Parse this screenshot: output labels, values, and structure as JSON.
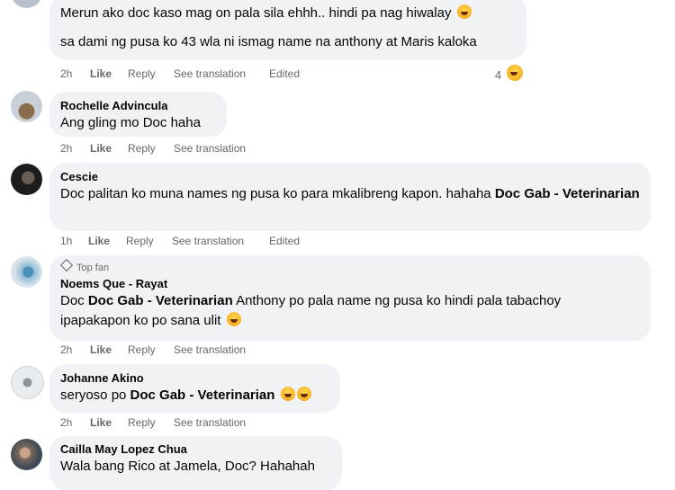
{
  "comments": [
    {
      "name": "",
      "line1": "Merun ako doc kaso mag on pala sila ehhh.. hindi pa nag hiwalay",
      "line2": "sa dami ng pusa ko 43 wla ni ismag name na anthony at Maris kaloka",
      "time": "2h",
      "like": "Like",
      "reply": "Reply",
      "translation": "See translation",
      "edited": "Edited",
      "reaction_count": "4"
    },
    {
      "name": "Rochelle Advincula",
      "text": "Ang gling mo Doc haha",
      "time": "2h",
      "like": "Like",
      "reply": "Reply",
      "translation": "See translation"
    },
    {
      "name": "Cescie",
      "text_before": "Doc palitan ko muna names ng pusa ko para mkalibreng kapon. hahaha ",
      "mention": "Doc Gab - Veterinarian",
      "time": "1h",
      "like": "Like",
      "reply": "Reply",
      "translation": "See translation",
      "edited": "Edited"
    },
    {
      "badge": "Top fan",
      "name": "Noems Que - Rayat",
      "text_prefix": "Doc ",
      "mention": "Doc Gab - Veterinarian",
      "text_after": " Anthony po pala name ng pusa ko hindi pala tabachoy",
      "line2": "ipapakapon ko po sana ulit",
      "time": "2h",
      "like": "Like",
      "reply": "Reply",
      "translation": "See translation"
    },
    {
      "name": "Johanne Akino",
      "text_prefix": "seryoso po ",
      "mention": "Doc Gab - Veterinarian",
      "time": "2h",
      "like": "Like",
      "reply": "Reply",
      "translation": "See translation"
    },
    {
      "name": "Cailla May Lopez Chua",
      "text": "Wala bang Rico at Jamela, Doc? Hahahah"
    }
  ],
  "colors": {
    "bubble": "#f0f2f5",
    "meta": "#65676b",
    "text": "#050505"
  },
  "icons": [
    "laughing-emoji-icon",
    "diamond-icon"
  ]
}
